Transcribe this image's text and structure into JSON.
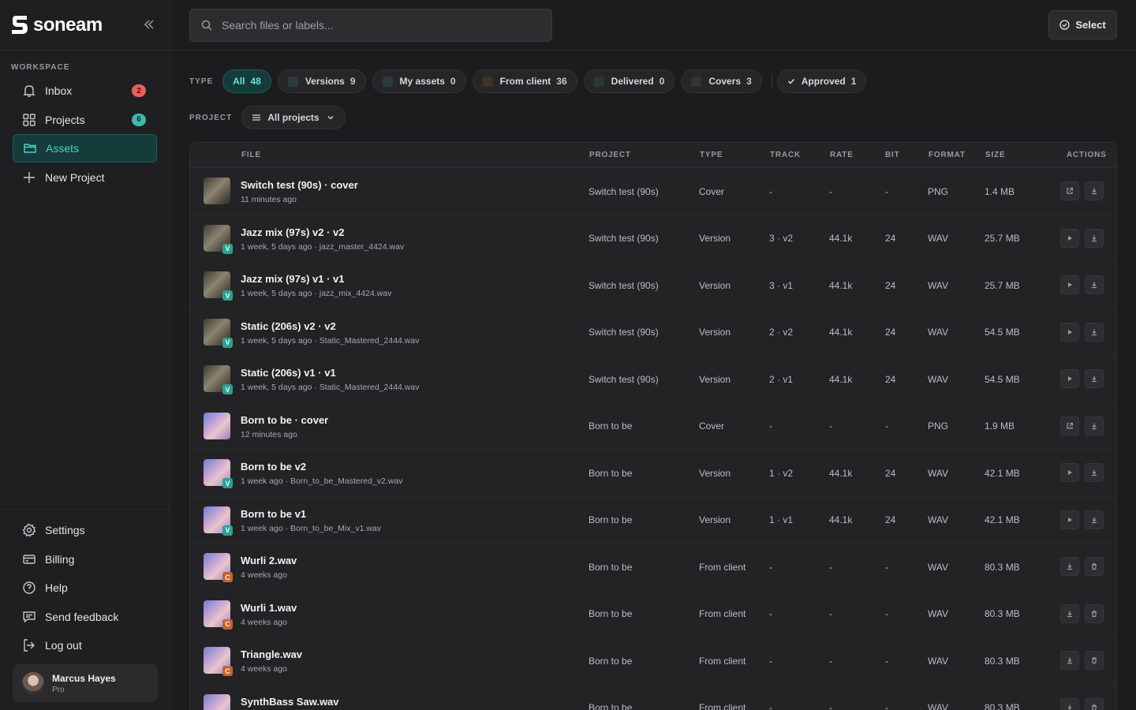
{
  "brand": {
    "name": "soneam"
  },
  "sidebar": {
    "section_label": "WORKSPACE",
    "items": [
      {
        "label": "Inbox",
        "icon": "bell-icon",
        "badge": "2",
        "badge_color": "#e8605a"
      },
      {
        "label": "Projects",
        "icon": "grid-icon",
        "badge": "6",
        "badge_color": "#3fb9ad"
      },
      {
        "label": "Assets",
        "icon": "folder-icon",
        "active": true
      },
      {
        "label": "New Project",
        "icon": "plus-icon"
      }
    ],
    "bottom_items": [
      {
        "label": "Settings",
        "icon": "gear-icon"
      },
      {
        "label": "Billing",
        "icon": "credit-card-icon"
      },
      {
        "label": "Help",
        "icon": "help-circle-icon"
      },
      {
        "label": "Send feedback",
        "icon": "message-icon"
      },
      {
        "label": "Log out",
        "icon": "logout-icon"
      }
    ],
    "user": {
      "name": "Marcus Hayes",
      "plan": "Pro"
    }
  },
  "search": {
    "placeholder": "Search files or labels..."
  },
  "toolbar": {
    "select_label": "Select"
  },
  "filters": {
    "type_label": "TYPE",
    "chips": [
      {
        "label": "All",
        "count": "48",
        "active": true,
        "color": ""
      },
      {
        "label": "Versions",
        "count": "9",
        "color": "#2a3c3a"
      },
      {
        "label": "My assets",
        "count": "0",
        "color": "#2a3a3e"
      },
      {
        "label": "From client",
        "count": "36",
        "color": "#3e3426"
      },
      {
        "label": "Delivered",
        "count": "0",
        "color": "#263a30"
      },
      {
        "label": "Covers",
        "count": "3",
        "color": "#333336"
      },
      {
        "label": "Approved",
        "count": "1",
        "color": "",
        "check": true
      }
    ],
    "project_label": "PROJECT",
    "project_value": "All projects"
  },
  "table": {
    "headers": [
      "FILE",
      "PROJECT",
      "TYPE",
      "TRACK",
      "RATE",
      "BIT",
      "FORMAT",
      "SIZE",
      "ACTIONS"
    ],
    "rows": [
      {
        "name": "Switch test (90s) · cover",
        "meta": "11 minutes ago",
        "project": "Switch test (90s)",
        "type": "Cover",
        "track": "-",
        "rate": "-",
        "bit": "-",
        "format": "PNG",
        "size": "1.4 MB",
        "thumb": "jazz",
        "badge": "",
        "actions": [
          "external-link-icon",
          "download-icon"
        ]
      },
      {
        "name": "Jazz mix (97s) v2 · v2",
        "meta": "1 week, 5 days ago · jazz_master_4424.wav",
        "project": "Switch test (90s)",
        "type": "Version",
        "track": "3 · v2",
        "rate": "44.1k",
        "bit": "24",
        "format": "WAV",
        "size": "25.7 MB",
        "thumb": "jazz",
        "badge": "V",
        "actions": [
          "play-icon",
          "download-icon"
        ]
      },
      {
        "name": "Jazz mix (97s) v1 · v1",
        "meta": "1 week, 5 days ago · jazz_mix_4424.wav",
        "project": "Switch test (90s)",
        "type": "Version",
        "track": "3 · v1",
        "rate": "44.1k",
        "bit": "24",
        "format": "WAV",
        "size": "25.7 MB",
        "thumb": "jazz",
        "badge": "V",
        "actions": [
          "play-icon",
          "download-icon"
        ]
      },
      {
        "name": "Static (206s) v2 · v2",
        "meta": "1 week, 5 days ago · Static_Mastered_2444.wav",
        "project": "Switch test (90s)",
        "type": "Version",
        "track": "2 · v2",
        "rate": "44.1k",
        "bit": "24",
        "format": "WAV",
        "size": "54.5 MB",
        "thumb": "jazz",
        "badge": "V",
        "actions": [
          "play-icon",
          "download-icon"
        ]
      },
      {
        "name": "Static (206s) v1 · v1",
        "meta": "1 week, 5 days ago · Static_Mastered_2444.wav",
        "project": "Switch test (90s)",
        "type": "Version",
        "track": "2 · v1",
        "rate": "44.1k",
        "bit": "24",
        "format": "WAV",
        "size": "54.5 MB",
        "thumb": "jazz",
        "badge": "V",
        "actions": [
          "play-icon",
          "download-icon"
        ]
      },
      {
        "name": "Born to be · cover",
        "meta": "12 minutes ago",
        "project": "Born to be",
        "type": "Cover",
        "track": "-",
        "rate": "-",
        "bit": "-",
        "format": "PNG",
        "size": "1.9 MB",
        "thumb": "born",
        "badge": "",
        "actions": [
          "external-link-icon",
          "download-icon"
        ]
      },
      {
        "name": "Born to be v2",
        "meta": "1 week ago · Born_to_be_Mastered_v2.wav",
        "project": "Born to be",
        "type": "Version",
        "track": "1 · v2",
        "rate": "44.1k",
        "bit": "24",
        "format": "WAV",
        "size": "42.1 MB",
        "thumb": "born",
        "badge": "V",
        "actions": [
          "play-icon",
          "download-icon"
        ]
      },
      {
        "name": "Born to be v1",
        "meta": "1 week ago · Born_to_be_Mix_v1.wav",
        "project": "Born to be",
        "type": "Version",
        "track": "1 · v1",
        "rate": "44.1k",
        "bit": "24",
        "format": "WAV",
        "size": "42.1 MB",
        "thumb": "born",
        "badge": "V",
        "actions": [
          "play-icon",
          "download-icon"
        ]
      },
      {
        "name": "Wurli 2.wav",
        "meta": "4 weeks ago",
        "project": "Born to be",
        "type": "From client",
        "track": "-",
        "rate": "-",
        "bit": "-",
        "format": "WAV",
        "size": "80.3 MB",
        "thumb": "born",
        "badge": "C",
        "actions": [
          "download-icon",
          "trash-icon"
        ]
      },
      {
        "name": "Wurli 1.wav",
        "meta": "4 weeks ago",
        "project": "Born to be",
        "type": "From client",
        "track": "-",
        "rate": "-",
        "bit": "-",
        "format": "WAV",
        "size": "80.3 MB",
        "thumb": "born",
        "badge": "C",
        "actions": [
          "download-icon",
          "trash-icon"
        ]
      },
      {
        "name": "Triangle.wav",
        "meta": "4 weeks ago",
        "project": "Born to be",
        "type": "From client",
        "track": "-",
        "rate": "-",
        "bit": "-",
        "format": "WAV",
        "size": "80.3 MB",
        "thumb": "born",
        "badge": "C",
        "actions": [
          "download-icon",
          "trash-icon"
        ]
      },
      {
        "name": "SynthBass Saw.wav",
        "meta": "",
        "project": "Born to be",
        "type": "From client",
        "track": "-",
        "rate": "-",
        "bit": "-",
        "format": "WAV",
        "size": "80.3 MB",
        "thumb": "born",
        "badge": "",
        "actions": [
          "download-icon",
          "trash-icon"
        ]
      }
    ]
  },
  "colors": {
    "accent": "#4fd1c5",
    "background": "#1c1c1e",
    "surface": "#232326"
  }
}
